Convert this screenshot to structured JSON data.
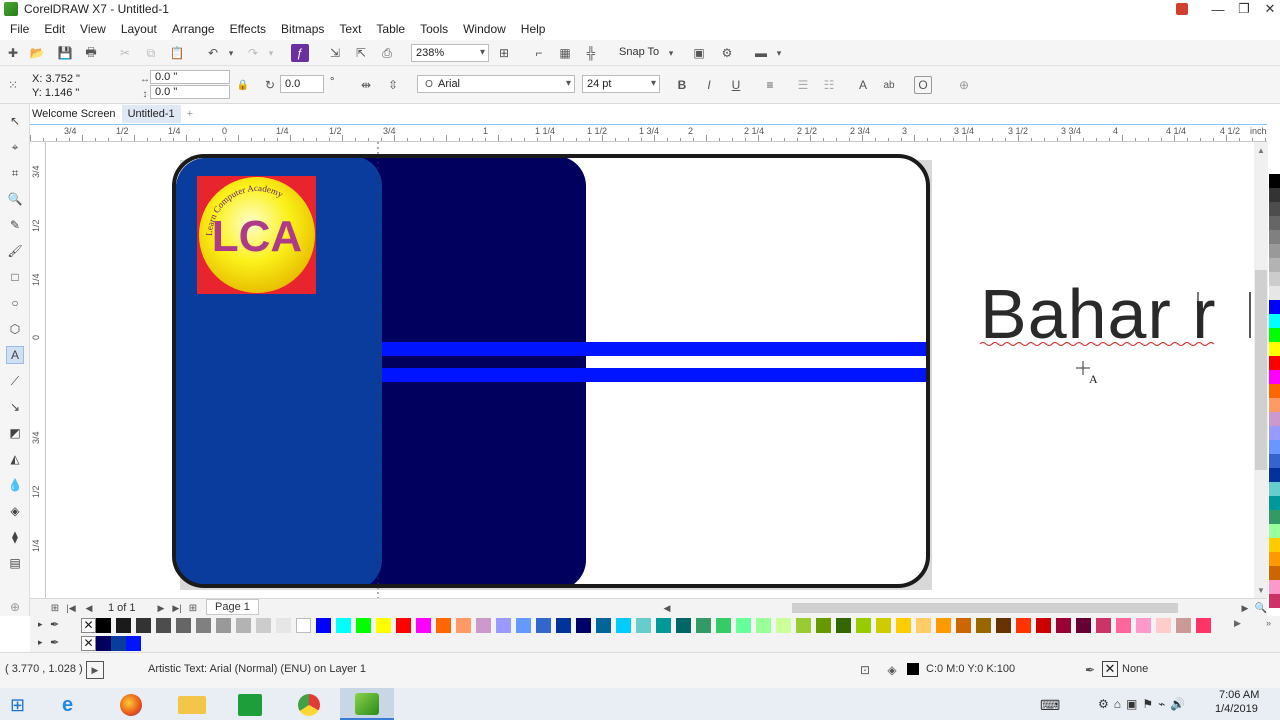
{
  "window": {
    "title": "CorelDRAW X7 - Untitled-1"
  },
  "menu": [
    "File",
    "Edit",
    "View",
    "Layout",
    "Arrange",
    "Effects",
    "Bitmaps",
    "Text",
    "Table",
    "Tools",
    "Window",
    "Help"
  ],
  "standard_toolbar": {
    "zoom": "238%",
    "snap_to": "Snap To"
  },
  "property_bar": {
    "x": "X: 3.752 \"",
    "y": "Y: 1.146 \"",
    "width": "0.0 \"",
    "height": "0.0 \"",
    "rotation": "0.0",
    "degree": "°",
    "font": "Arial",
    "font_size": "24 pt"
  },
  "doc_tabs": [
    "Welcome Screen",
    "Untitled-1"
  ],
  "ruler": {
    "h_labels": [
      "3/4",
      "1/2",
      "1/4",
      "0",
      "1/4",
      "1/2",
      "3/4",
      "1",
      "1 1/4",
      "1 1/2",
      "1 3/4",
      "2",
      "2 1/4",
      "2 1/2",
      "2 3/4",
      "3",
      "3 1/4",
      "3 1/2",
      "3 3/4",
      "4",
      "4 1/4",
      "4 1/2",
      "inches"
    ],
    "v_labels": [
      "3/4",
      "1/2",
      "1/4",
      "0",
      "3/4",
      "1/2",
      "1/4"
    ]
  },
  "card": {
    "logo_text": "LCA",
    "logo_arc": "Learn Computer Academy",
    "colors": {
      "left_panel": "#0a3c9e",
      "mid_panel": "#01005e",
      "stripe": "#0014ff",
      "logo_bg": "#e8252f",
      "logo_circle": "#f5e600"
    }
  },
  "artistic_text": "Bahar r",
  "page_nav": {
    "count": "1 of 1",
    "page_tab": "Page 1"
  },
  "status": {
    "coords": "( 3.770 , 1.028 )",
    "object_info": "Artistic Text: Arial (Normal) (ENU) on Layer 1",
    "fill": "C:0 M:0 Y:0 K:100",
    "outline": "None"
  },
  "taskbar": {
    "time": "7:06 AM",
    "date": "1/4/2019"
  },
  "palette_colors": [
    "#000000",
    "#1a1a1a",
    "#333333",
    "#4d4d4d",
    "#666666",
    "#808080",
    "#999999",
    "#b3b3b3",
    "#cccccc",
    "#e6e6e6",
    "#ffffff",
    "#0000ff",
    "#00ffff",
    "#00ff00",
    "#ffff00",
    "#ff0000",
    "#ff00ff",
    "#ff6600",
    "#ff9966",
    "#cc99cc",
    "#9999ff",
    "#6699ff",
    "#3366cc",
    "#003399",
    "#000066",
    "#006699",
    "#00ccff",
    "#66cccc",
    "#009999",
    "#006666",
    "#339966",
    "#33cc66",
    "#66ff99",
    "#99ff99",
    "#ccff99",
    "#99cc33",
    "#669900",
    "#336600",
    "#99cc00",
    "#cccc00",
    "#ffcc00",
    "#ffcc66",
    "#ff9900",
    "#cc6600",
    "#996600",
    "#663300",
    "#ff3300",
    "#cc0000",
    "#990033",
    "#660033",
    "#cc3366",
    "#ff6699",
    "#ff99cc",
    "#ffcccc",
    "#cc9999",
    "#ff3366"
  ]
}
